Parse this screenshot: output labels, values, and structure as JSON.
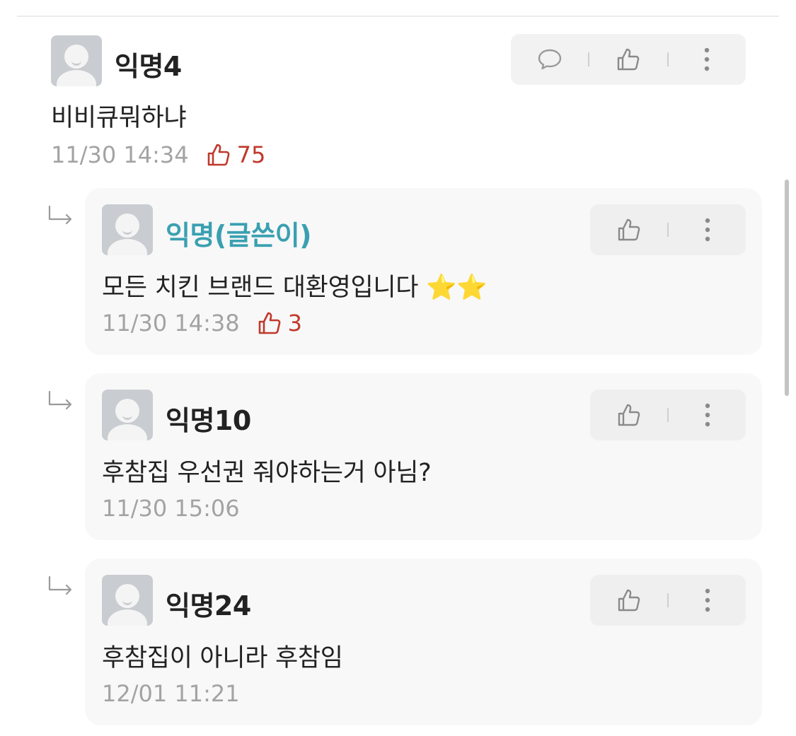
{
  "comments": [
    {
      "name": "익명4",
      "text": "비비큐뭐하냐",
      "time": "11/30 14:34",
      "likes": "75"
    }
  ],
  "replies": [
    {
      "name": "익명(글쓴이)",
      "text": "모든 치킨 브랜드 대환영입니다 ⭐⭐",
      "time": "11/30 14:38",
      "likes": "3",
      "is_author": true
    },
    {
      "name": "익명10",
      "text": "후참집 우선권 줘야하는거 아님?",
      "time": "11/30 15:06"
    },
    {
      "name": "익명24",
      "text": "후참집이 아니라 후참임",
      "time": "12/01 11:21"
    }
  ],
  "colors": {
    "author_name": "#3aa0b1",
    "like_accent": "#c0392b",
    "meta_gray": "#a3a3a3",
    "reply_bg": "#f8f8f8"
  },
  "icons": {
    "comment": "speech-bubble-icon",
    "like": "thumbs-up-icon",
    "more": "vertical-ellipsis-icon",
    "reply_arrow": "reply-arrow-icon"
  }
}
